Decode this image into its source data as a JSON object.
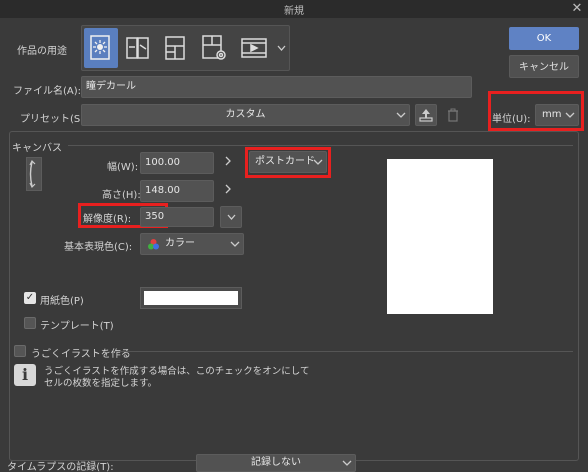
{
  "window": {
    "title": "新規",
    "close_glyph": "✕"
  },
  "usage": {
    "label": "作品の用途",
    "icons": [
      "illustration-icon",
      "comic-icon",
      "comic-panel-icon",
      "comic-settings-icon",
      "animation-icon"
    ],
    "selected_index": 0
  },
  "buttons": {
    "ok": "OK",
    "cancel": "キャンセル"
  },
  "file": {
    "label": "ファイル名(A):",
    "value": "瞳デカール"
  },
  "preset": {
    "label": "プリセット(S):",
    "value": "カスタム"
  },
  "unit": {
    "label": "単位(U):",
    "value": "mm"
  },
  "canvas": {
    "section_label": "キャンバス",
    "width_label": "幅(W):",
    "width_value": "100.00",
    "height_label": "高さ(H):",
    "height_value": "148.00",
    "size_preset_value": "ポストカード",
    "resolution_label": "解像度(R):",
    "resolution_value": "350",
    "color_label": "基本表現色(C):",
    "color_value": "カラー",
    "paper_color_label": "用紙色(P)",
    "paper_color_checked": true,
    "paper_color": "#ffffff",
    "template_label": "テンプレート(T)",
    "template_checked": false
  },
  "animation": {
    "label": "うごくイラストを作る",
    "checked": false,
    "info_line1": "うごくイラストを作成する場合は、このチェックをオンにして",
    "info_line2": "セルの枚数を指定します。"
  },
  "timelapse": {
    "label": "タイムラプスの記録(T):",
    "value": "記録しない"
  },
  "colors": {
    "accent": "#5f82c4",
    "highlight": "#e8201f",
    "background": "#3a3a3a"
  }
}
